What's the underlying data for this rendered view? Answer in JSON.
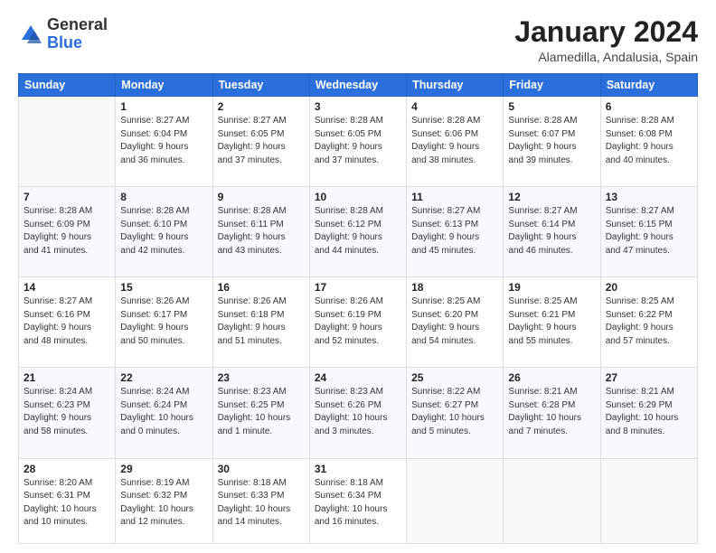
{
  "header": {
    "logo_general": "General",
    "logo_blue": "Blue",
    "month_year": "January 2024",
    "location": "Alamedilla, Andalusia, Spain"
  },
  "weekdays": [
    "Sunday",
    "Monday",
    "Tuesday",
    "Wednesday",
    "Thursday",
    "Friday",
    "Saturday"
  ],
  "weeks": [
    [
      {
        "day": "",
        "info": ""
      },
      {
        "day": "1",
        "info": "Sunrise: 8:27 AM\nSunset: 6:04 PM\nDaylight: 9 hours\nand 36 minutes."
      },
      {
        "day": "2",
        "info": "Sunrise: 8:27 AM\nSunset: 6:05 PM\nDaylight: 9 hours\nand 37 minutes."
      },
      {
        "day": "3",
        "info": "Sunrise: 8:28 AM\nSunset: 6:05 PM\nDaylight: 9 hours\nand 37 minutes."
      },
      {
        "day": "4",
        "info": "Sunrise: 8:28 AM\nSunset: 6:06 PM\nDaylight: 9 hours\nand 38 minutes."
      },
      {
        "day": "5",
        "info": "Sunrise: 8:28 AM\nSunset: 6:07 PM\nDaylight: 9 hours\nand 39 minutes."
      },
      {
        "day": "6",
        "info": "Sunrise: 8:28 AM\nSunset: 6:08 PM\nDaylight: 9 hours\nand 40 minutes."
      }
    ],
    [
      {
        "day": "7",
        "info": "Sunrise: 8:28 AM\nSunset: 6:09 PM\nDaylight: 9 hours\nand 41 minutes."
      },
      {
        "day": "8",
        "info": "Sunrise: 8:28 AM\nSunset: 6:10 PM\nDaylight: 9 hours\nand 42 minutes."
      },
      {
        "day": "9",
        "info": "Sunrise: 8:28 AM\nSunset: 6:11 PM\nDaylight: 9 hours\nand 43 minutes."
      },
      {
        "day": "10",
        "info": "Sunrise: 8:28 AM\nSunset: 6:12 PM\nDaylight: 9 hours\nand 44 minutes."
      },
      {
        "day": "11",
        "info": "Sunrise: 8:27 AM\nSunset: 6:13 PM\nDaylight: 9 hours\nand 45 minutes."
      },
      {
        "day": "12",
        "info": "Sunrise: 8:27 AM\nSunset: 6:14 PM\nDaylight: 9 hours\nand 46 minutes."
      },
      {
        "day": "13",
        "info": "Sunrise: 8:27 AM\nSunset: 6:15 PM\nDaylight: 9 hours\nand 47 minutes."
      }
    ],
    [
      {
        "day": "14",
        "info": "Sunrise: 8:27 AM\nSunset: 6:16 PM\nDaylight: 9 hours\nand 48 minutes."
      },
      {
        "day": "15",
        "info": "Sunrise: 8:26 AM\nSunset: 6:17 PM\nDaylight: 9 hours\nand 50 minutes."
      },
      {
        "day": "16",
        "info": "Sunrise: 8:26 AM\nSunset: 6:18 PM\nDaylight: 9 hours\nand 51 minutes."
      },
      {
        "day": "17",
        "info": "Sunrise: 8:26 AM\nSunset: 6:19 PM\nDaylight: 9 hours\nand 52 minutes."
      },
      {
        "day": "18",
        "info": "Sunrise: 8:25 AM\nSunset: 6:20 PM\nDaylight: 9 hours\nand 54 minutes."
      },
      {
        "day": "19",
        "info": "Sunrise: 8:25 AM\nSunset: 6:21 PM\nDaylight: 9 hours\nand 55 minutes."
      },
      {
        "day": "20",
        "info": "Sunrise: 8:25 AM\nSunset: 6:22 PM\nDaylight: 9 hours\nand 57 minutes."
      }
    ],
    [
      {
        "day": "21",
        "info": "Sunrise: 8:24 AM\nSunset: 6:23 PM\nDaylight: 9 hours\nand 58 minutes."
      },
      {
        "day": "22",
        "info": "Sunrise: 8:24 AM\nSunset: 6:24 PM\nDaylight: 10 hours\nand 0 minutes."
      },
      {
        "day": "23",
        "info": "Sunrise: 8:23 AM\nSunset: 6:25 PM\nDaylight: 10 hours\nand 1 minute."
      },
      {
        "day": "24",
        "info": "Sunrise: 8:23 AM\nSunset: 6:26 PM\nDaylight: 10 hours\nand 3 minutes."
      },
      {
        "day": "25",
        "info": "Sunrise: 8:22 AM\nSunset: 6:27 PM\nDaylight: 10 hours\nand 5 minutes."
      },
      {
        "day": "26",
        "info": "Sunrise: 8:21 AM\nSunset: 6:28 PM\nDaylight: 10 hours\nand 7 minutes."
      },
      {
        "day": "27",
        "info": "Sunrise: 8:21 AM\nSunset: 6:29 PM\nDaylight: 10 hours\nand 8 minutes."
      }
    ],
    [
      {
        "day": "28",
        "info": "Sunrise: 8:20 AM\nSunset: 6:31 PM\nDaylight: 10 hours\nand 10 minutes."
      },
      {
        "day": "29",
        "info": "Sunrise: 8:19 AM\nSunset: 6:32 PM\nDaylight: 10 hours\nand 12 minutes."
      },
      {
        "day": "30",
        "info": "Sunrise: 8:18 AM\nSunset: 6:33 PM\nDaylight: 10 hours\nand 14 minutes."
      },
      {
        "day": "31",
        "info": "Sunrise: 8:18 AM\nSunset: 6:34 PM\nDaylight: 10 hours\nand 16 minutes."
      },
      {
        "day": "",
        "info": ""
      },
      {
        "day": "",
        "info": ""
      },
      {
        "day": "",
        "info": ""
      }
    ]
  ]
}
